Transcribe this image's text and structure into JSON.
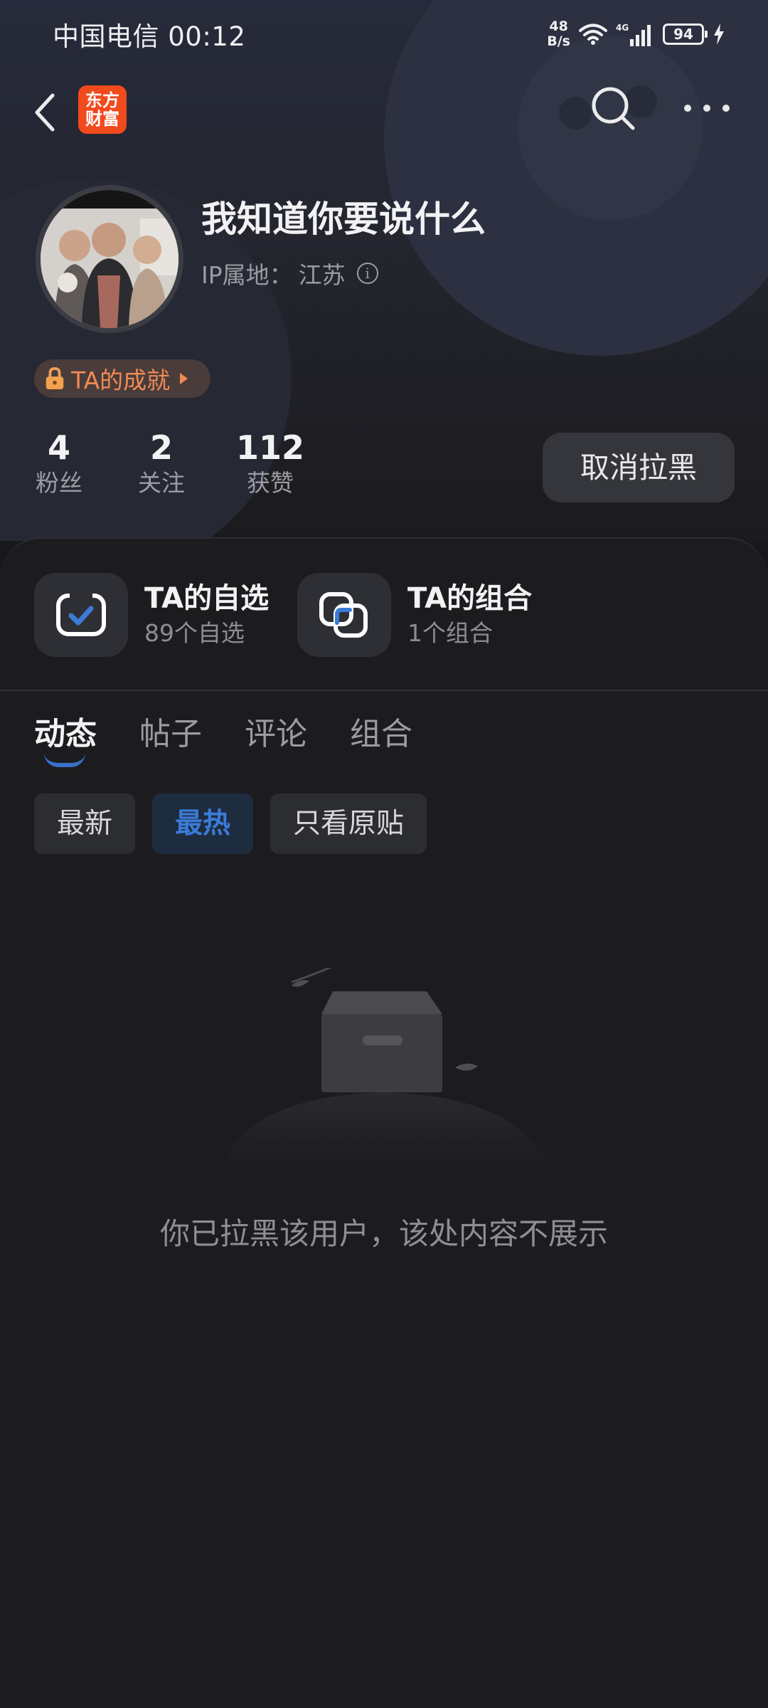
{
  "status_bar": {
    "carrier_time": "中国电信 00:12",
    "net_speed_value": "48",
    "net_speed_unit": "B/s",
    "network": "4G",
    "battery": "94"
  },
  "nav": {
    "logo_line1": "东方",
    "logo_line2": "财富",
    "logo_color": "#f14a1d"
  },
  "profile": {
    "nickname": "我知道你要说什么",
    "ip_label": "IP属地：",
    "ip_location": "江苏",
    "info_glyph": "i",
    "achievement": "TA的成就"
  },
  "stats": [
    {
      "value": "4",
      "label": "粉丝"
    },
    {
      "value": "2",
      "label": "关注"
    },
    {
      "value": "112",
      "label": "获赞"
    }
  ],
  "unblock_button": "取消拉黑",
  "features": [
    {
      "title": "TA的自选",
      "subtitle": "89个自选"
    },
    {
      "title": "TA的组合",
      "subtitle": "1个组合"
    }
  ],
  "tabs": [
    "动态",
    "帖子",
    "评论",
    "组合"
  ],
  "filters": [
    "最新",
    "最热",
    "只看原贴"
  ],
  "empty_message": "你已拉黑该用户，该处内容不展示",
  "colors": {
    "accent_blue": "#3b7bd8",
    "achievement_orange": "#f08a55",
    "background": "#18181b"
  }
}
